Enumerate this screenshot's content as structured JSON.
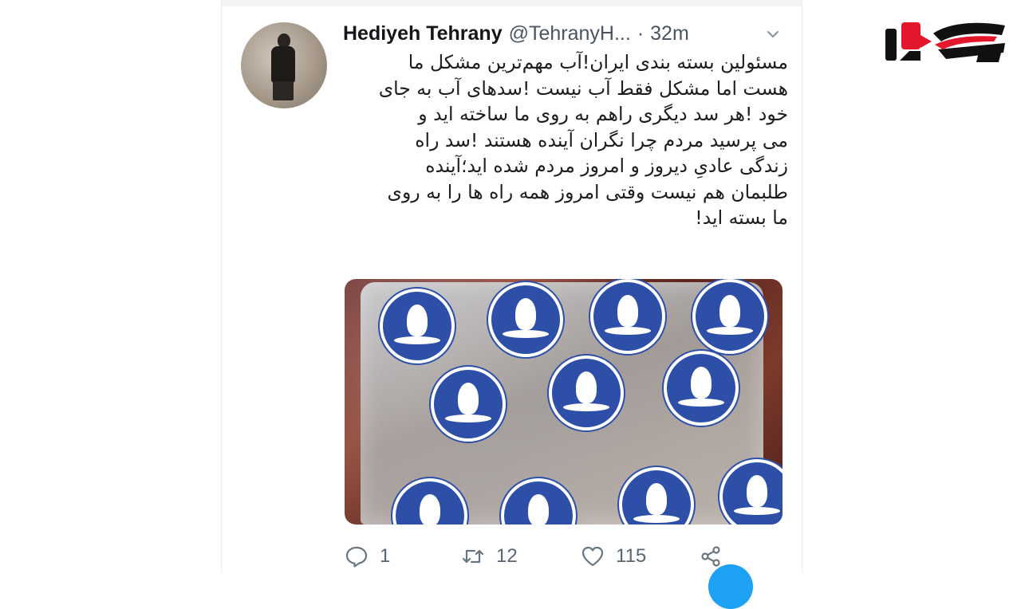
{
  "tweet": {
    "author_name": "Hediyeh Tehrany",
    "author_handle": "@TehranyH...",
    "separator": "·",
    "time": "32m",
    "text": "مسئولین بسته بندی ایران!آب مهم‌ترین مشکل ما\nهست اما مشکل فقط آب نیست !سدهای آب به جای\nخود !هر سد دیگری راهم به روی ما ساخته اید و\nمی پرسید مردم چرا نگران آینده هستند !سد راه\nزندگی عادیِ دیروز و امروز مردم شده اید؛آینده\nطلبمان هم نیست وقتی امروز همه راه ها را به روی\nما بسته اید!",
    "media_description_icon": "water-bag-photo"
  },
  "actions": {
    "reply_count": "1",
    "retweet_count": "12",
    "like_count": "115"
  },
  "icons": {
    "reply": "reply-icon",
    "retweet": "retweet-icon",
    "like": "heart-icon",
    "share": "share-icon",
    "menu": "chevron-down-icon"
  },
  "colors": {
    "brand_red": "#e3172b",
    "brand_black": "#111111",
    "twitter_blue": "#1da1f2"
  }
}
